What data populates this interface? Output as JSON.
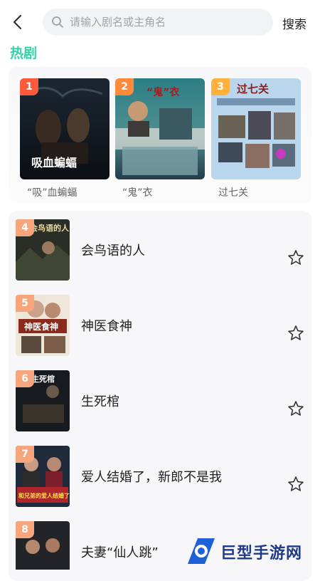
{
  "search": {
    "placeholder": "请输入剧名或主角名",
    "button_label": "搜索"
  },
  "section": {
    "title": "热剧"
  },
  "hot": [
    {
      "rank": "1",
      "title": "“吸”血蝙蝠",
      "poster_text": "吸血蝙蝠",
      "badge_color": "#ff5a3c"
    },
    {
      "rank": "2",
      "title": "“鬼”衣",
      "poster_text": "“鬼”衣",
      "badge_color": "#ff8a3c"
    },
    {
      "rank": "3",
      "title": "过七关",
      "poster_text": "过七关",
      "badge_color": "#ffb13c"
    }
  ],
  "list": [
    {
      "rank": "4",
      "title": "会鸟语的人",
      "poster_text": "会鸟语的人"
    },
    {
      "rank": "5",
      "title": "神医食神",
      "poster_text": "神医食神"
    },
    {
      "rank": "6",
      "title": "生死棺",
      "poster_text": "生死棺"
    },
    {
      "rank": "7",
      "title": "爱人结婚了，新郎不是我",
      "poster_text": "和兄弟的爱人结婚了"
    },
    {
      "rank": "8",
      "title": "夫妻“仙人跳”",
      "poster_text": ""
    }
  ],
  "watermark": {
    "text": "巨型手游网"
  },
  "colors": {
    "accent": "#32d3a8",
    "list_badge": "#f7a57c"
  }
}
